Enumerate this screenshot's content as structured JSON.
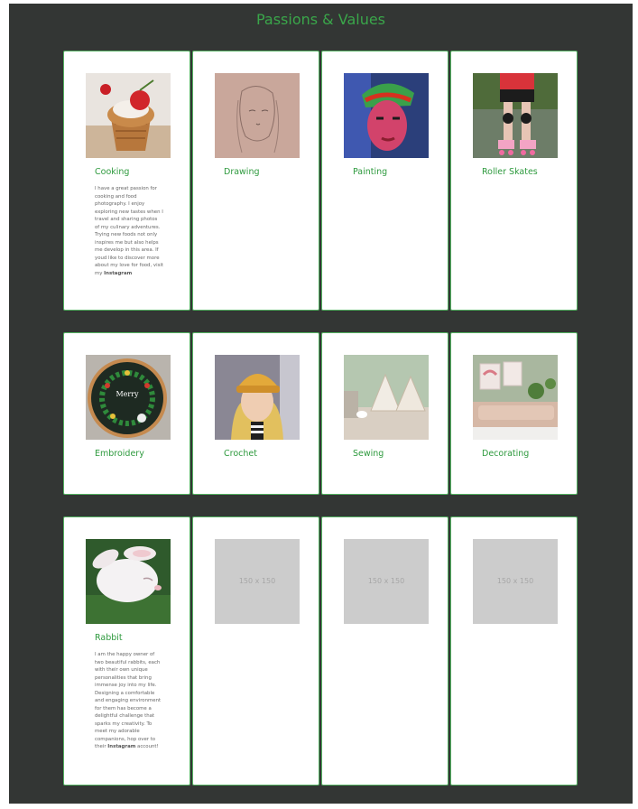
{
  "page": {
    "title": "Passions & Values"
  },
  "cards": [
    {
      "label": "Cooking",
      "description": "I have a great passion for cooking and food photography. I enjoy exploring new tastes when I travel and sharing photos of my culinary adventures. Trying new foods not only inspires me but also helps me develop in this area. If youd like to discover more about my love for food, visit my",
      "link": "Instagram"
    },
    {
      "label": "Drawing"
    },
    {
      "label": "Painting"
    },
    {
      "label": "Roller Skates"
    },
    {
      "label": "Embroidery"
    },
    {
      "label": "Crochet"
    },
    {
      "label": "Sewing"
    },
    {
      "label": "Decorating"
    },
    {
      "label": "Rabbit",
      "description": "I am the happy owner of two beautiful rabbits, each with their own unique personalities that bring immense joy into my life. Designing a comfortable and engaging environment for them has become a delightful challenge that sparks my creativity. To meet my adorable companions, hop over to their",
      "link": "Instagram",
      "link_suffix": " account!"
    },
    {
      "placeholder": "150 x 150"
    },
    {
      "placeholder": "150 x 150"
    },
    {
      "placeholder": "150 x 150"
    }
  ],
  "colors": {
    "background": "#333634",
    "accent": "#3aa64a",
    "border": "#52b060",
    "placeholder": "#cccccc"
  }
}
